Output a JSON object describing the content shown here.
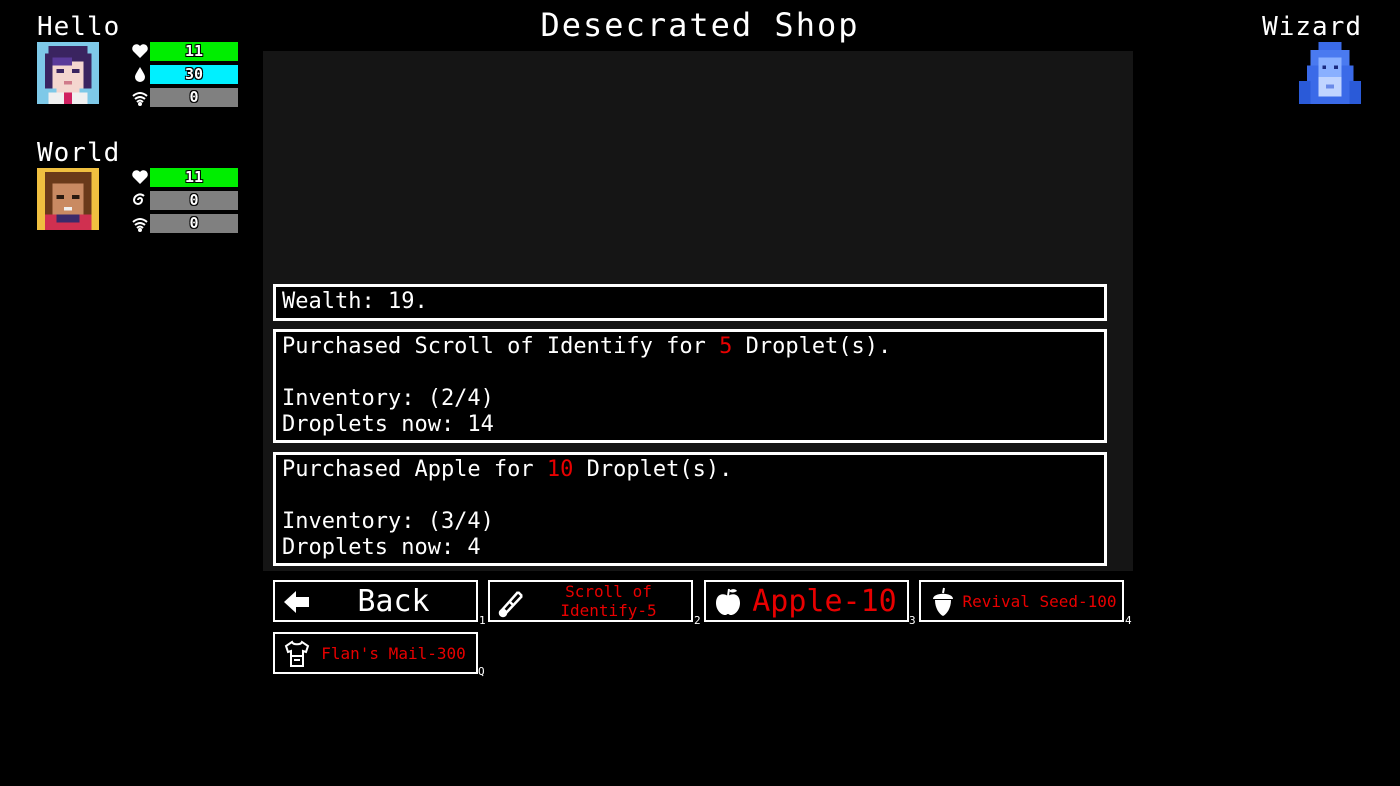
{
  "shop_title": "Desecrated Shop",
  "party": [
    {
      "name": "Hello",
      "stats": [
        {
          "icon": "heart-icon",
          "value": "11",
          "fill": 1.0,
          "color": "#00ee00"
        },
        {
          "icon": "droplet-icon",
          "value": "30",
          "fill": 1.0,
          "color": "#00f0ff"
        },
        {
          "icon": "wifi-icon",
          "value": "0",
          "fill": 0,
          "color": "#808080"
        }
      ]
    },
    {
      "name": "World",
      "stats": [
        {
          "icon": "heart-icon",
          "value": "11",
          "fill": 1.0,
          "color": "#00ee00"
        },
        {
          "icon": "swirl-icon",
          "value": "0",
          "fill": 0,
          "color": "#808080"
        },
        {
          "icon": "wifi-icon",
          "value": "0",
          "fill": 0,
          "color": "#808080"
        }
      ]
    }
  ],
  "enemy": {
    "name": "Wizard"
  },
  "messages": {
    "wealth": "Wealth: 19.",
    "purchase1": {
      "pre": "Purchased Scroll of Identify for ",
      "amount": "5",
      "post": " Droplet(s).",
      "inventory": "Inventory: (2/4)",
      "droplets": "Droplets now: 14"
    },
    "purchase2": {
      "pre": "Purchased Apple for ",
      "amount": "10",
      "post": " Droplet(s).",
      "inventory": "Inventory: (3/4)",
      "droplets": "Droplets now: 4"
    }
  },
  "actions": [
    {
      "label": "Back",
      "icon": "arrow-left-icon",
      "hotkey": "1"
    },
    {
      "label": "Scroll of Identify-5",
      "icon": "scroll-icon",
      "hotkey": "2"
    },
    {
      "label": "Apple-10",
      "icon": "apple-icon",
      "hotkey": "3"
    },
    {
      "label": "Revival Seed-100",
      "icon": "acorn-icon",
      "hotkey": "4"
    },
    {
      "label": "Flan's Mail-300",
      "icon": "shirt-icon",
      "hotkey": "Q"
    }
  ],
  "colors": {
    "accent_red": "#e80000",
    "hp_green": "#00ee00",
    "mana_cyan": "#00f0ff"
  }
}
